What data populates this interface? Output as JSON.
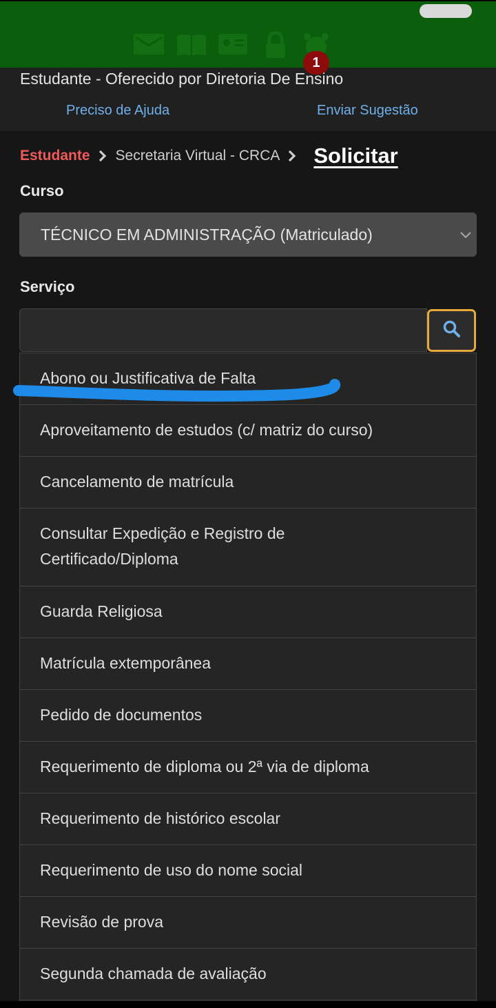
{
  "header": {
    "nav_icons": [
      "mail-icon",
      "book-icon",
      "id-card-icon",
      "lock-icon",
      "alarm-icon"
    ],
    "notification_count": "1",
    "provider_text": "Estudante - Oferecido por Diretoria De Ensino",
    "help_link": "Preciso de Ajuda",
    "suggest_link": "Enviar Sugestão"
  },
  "breadcrumb": {
    "root": "Estudante",
    "section": "Secretaria Virtual - CRCA",
    "current": "Solicitar"
  },
  "form": {
    "course_label": "Curso",
    "course_value": "TÉCNICO EM ADMINISTRAÇÃO (Matriculado)",
    "service_label": "Serviço",
    "service_value": "",
    "search_icon": "search-icon"
  },
  "services": [
    "Abono ou Justificativa de Falta",
    "Aproveitamento de estudos (c/ matriz do curso)",
    "Cancelamento de matrícula",
    "Consultar Expedição e Registro de Certificado/Diploma",
    "Guarda Religiosa",
    "Matrícula extemporânea",
    "Pedido de documentos",
    "Requerimento de diploma ou 2ª via de diploma",
    "Requerimento de histórico escolar",
    "Requerimento de uso do nome social",
    "Revisão de prova",
    "Segunda chamada de avaliação"
  ],
  "colors": {
    "header_green": "#0b5e0b",
    "breadcrumb_red": "#ef5a5a",
    "link_blue": "#6fb0ea",
    "search_border": "#e8a93c",
    "highlight_stroke": "#1e8be8"
  }
}
